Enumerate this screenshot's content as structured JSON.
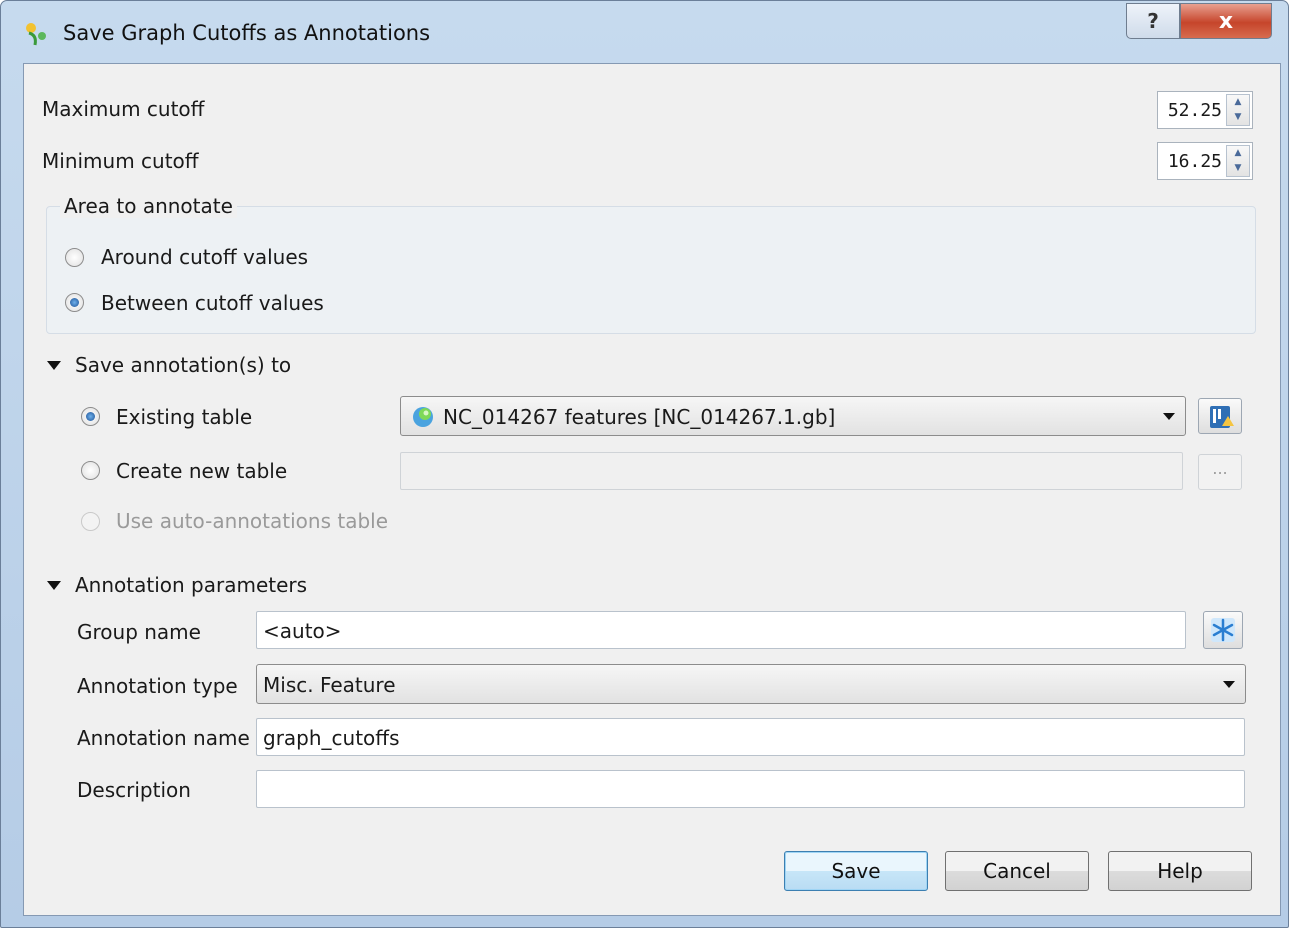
{
  "window": {
    "title": "Save Graph Cutoffs as Annotations",
    "help_glyph": "?",
    "close_glyph": "x"
  },
  "cutoffs": {
    "max_label": "Maximum cutoff",
    "max_value": "52.25",
    "min_label": "Minimum cutoff",
    "min_value": "16.25"
  },
  "area": {
    "title": "Area to annotate",
    "options": [
      {
        "label": "Around cutoff values",
        "checked": false
      },
      {
        "label": "Between cutoff values",
        "checked": true
      }
    ]
  },
  "save_to": {
    "section_label": "Save annotation(s) to",
    "existing_label": "Existing table",
    "existing_value": "NC_014267 features [NC_014267.1.gb]",
    "create_label": "Create new table",
    "create_value": "",
    "browse_label": "...",
    "auto_label": "Use auto-annotations table"
  },
  "params": {
    "section_label": "Annotation parameters",
    "group_name_label": "Group name",
    "group_name_value": "<auto>",
    "type_label": "Annotation type",
    "type_value": "Misc. Feature",
    "name_label": "Annotation name",
    "name_value": "graph_cutoffs",
    "description_label": "Description",
    "description_value": ""
  },
  "buttons": {
    "save": "Save",
    "cancel": "Cancel",
    "help": "Help"
  },
  "colors": {
    "accent": "#3c7fb1",
    "close": "#c6452b"
  }
}
